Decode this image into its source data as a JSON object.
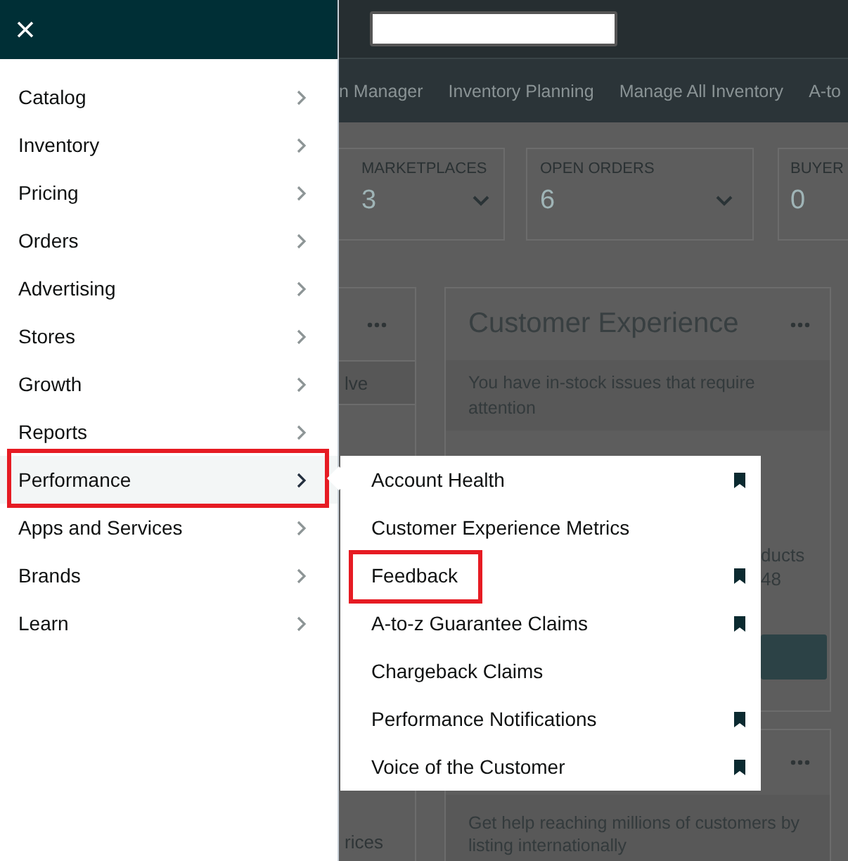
{
  "nav_tabs": [
    "n Manager",
    "Inventory Planning",
    "Manage All Inventory",
    "A-to"
  ],
  "stat_cards": [
    {
      "label": "MARKETPLACES",
      "value": "3",
      "has_menu": true
    },
    {
      "label": "OPEN ORDERS",
      "value": "6",
      "has_menu": true
    },
    {
      "label": "BUYER",
      "value": "0",
      "has_menu": false
    }
  ],
  "left_card": {
    "band_text": "lve",
    "bottom_text": "rices"
  },
  "customer_experience": {
    "title": "Customer Experience",
    "alert": "You have in-stock issues that require attention",
    "fragment_1": "ducts",
    "fragment_2": "48"
  },
  "global_card": {
    "text": "Get help reaching millions of customers by listing internationally"
  },
  "sidebar": {
    "items": [
      {
        "label": "Catalog",
        "selected": false,
        "annotated": false
      },
      {
        "label": "Inventory",
        "selected": false,
        "annotated": false
      },
      {
        "label": "Pricing",
        "selected": false,
        "annotated": false
      },
      {
        "label": "Orders",
        "selected": false,
        "annotated": false
      },
      {
        "label": "Advertising",
        "selected": false,
        "annotated": false
      },
      {
        "label": "Stores",
        "selected": false,
        "annotated": false
      },
      {
        "label": "Growth",
        "selected": false,
        "annotated": false
      },
      {
        "label": "Reports",
        "selected": false,
        "annotated": false
      },
      {
        "label": "Performance",
        "selected": true,
        "annotated": true
      },
      {
        "label": "Apps and Services",
        "selected": false,
        "annotated": false
      },
      {
        "label": "Brands",
        "selected": false,
        "annotated": false
      },
      {
        "label": "Learn",
        "selected": false,
        "annotated": false
      }
    ]
  },
  "submenu": {
    "items": [
      {
        "label": "Account Health",
        "bookmarked": true,
        "annotated": false
      },
      {
        "label": "Customer Experience Metrics",
        "bookmarked": false,
        "annotated": false
      },
      {
        "label": "Feedback",
        "bookmarked": true,
        "annotated": true
      },
      {
        "label": "A-to-z Guarantee Claims",
        "bookmarked": true,
        "annotated": false
      },
      {
        "label": "Chargeback Claims",
        "bookmarked": false,
        "annotated": false
      },
      {
        "label": "Performance Notifications",
        "bookmarked": true,
        "annotated": false
      },
      {
        "label": "Voice of the Customer",
        "bookmarked": true,
        "annotated": false
      }
    ]
  }
}
